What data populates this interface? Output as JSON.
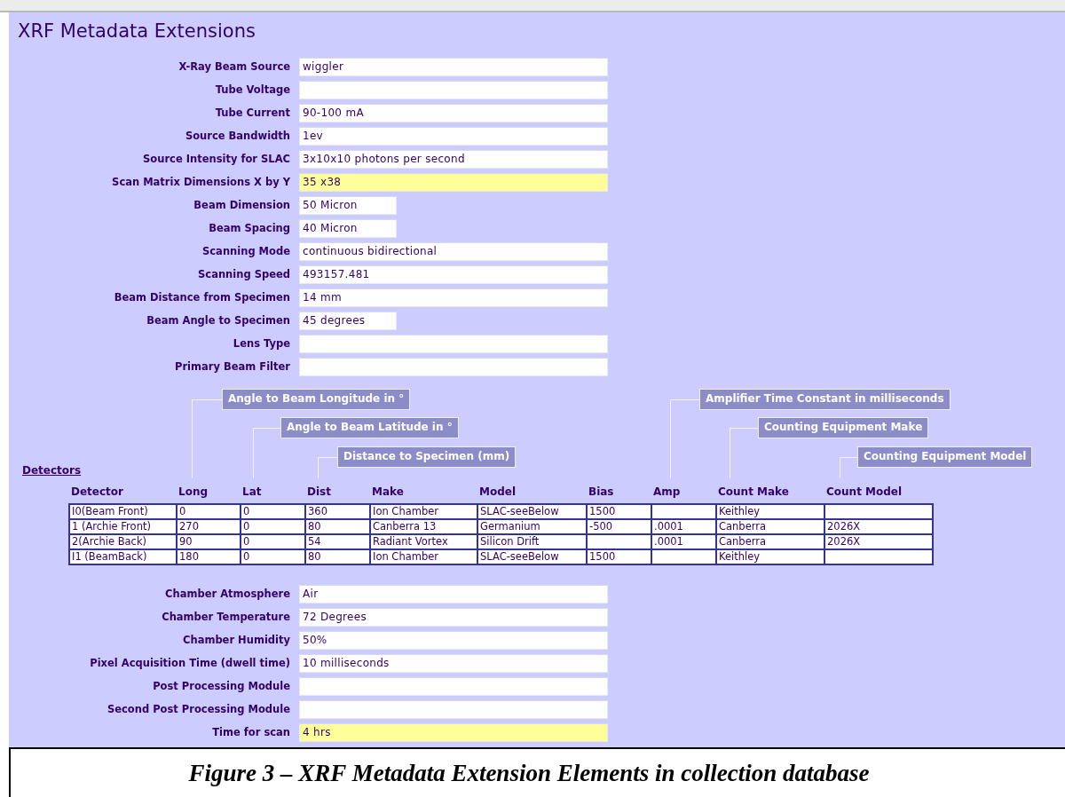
{
  "title": "XRF Metadata Extensions",
  "source_fields": [
    {
      "label": "X-Ray Beam Source",
      "value": "wiggler",
      "kind": "long",
      "highlighted": false
    },
    {
      "label": "Tube Voltage",
      "kind": "long",
      "highlighted": false
    },
    {
      "label": "Tube Current",
      "value": "90-100 mA",
      "kind": "long",
      "highlighted": false
    },
    {
      "label": "Source Bandwidth",
      "value": "1ev",
      "kind": "long",
      "highlighted": false
    },
    {
      "label": "Source Intensity for SLAC",
      "value": "3x10x10 photons per second",
      "kind": "long",
      "highlighted": false
    },
    {
      "label": "Scan Matrix Dimensions X by Y",
      "value": "35 x38",
      "kind": "long",
      "highlighted": true
    },
    {
      "label": "Beam Dimension",
      "value": "50 Micron",
      "kind": "short",
      "highlighted": false
    },
    {
      "label": "Beam Spacing",
      "value": "40 Micron",
      "kind": "short",
      "highlighted": false
    },
    {
      "label": "Scanning Mode",
      "value": "continuous bidirectional",
      "kind": "long",
      "highlighted": false
    },
    {
      "label": "Scanning Speed",
      "value": "493157.481",
      "kind": "long",
      "highlighted": false
    },
    {
      "label": "Beam Distance from Specimen",
      "value": "14 mm",
      "kind": "long",
      "highlighted": false
    },
    {
      "label": "Beam Angle to Specimen",
      "value": "45 degrees",
      "kind": "short",
      "highlighted": false
    },
    {
      "label": "Lens Type",
      "kind": "long",
      "highlighted": false
    },
    {
      "label": "Primary Beam Filter",
      "kind": "long",
      "highlighted": false
    }
  ],
  "callouts": [
    {
      "text": "Angle to Beam Longitude in °"
    },
    {
      "text": "Angle to Beam Latitude in °"
    },
    {
      "text": "Distance to Specimen (mm)"
    },
    {
      "text": "Amplifier Time Constant in milliseconds"
    },
    {
      "text": "Counting Equipment Make"
    },
    {
      "text": "Counting Equipment Model"
    }
  ],
  "detectors_heading": "Detectors",
  "table": {
    "columns": [
      "Detector",
      "Long",
      "Lat",
      "Dist",
      "Make",
      "Model",
      "Bias",
      "Amp",
      "Count Make",
      "Count Model"
    ],
    "rows": [
      [
        "I0(Beam Front)",
        "0",
        "0",
        "360",
        "Ion Chamber",
        "SLAC-seeBelow",
        "1500",
        "",
        "Keithley",
        ""
      ],
      [
        "1 (Archie Front)",
        "270",
        "0",
        "80",
        "Canberra 13",
        "Germanium",
        "-500",
        ".0001",
        "Canberra",
        "2026X"
      ],
      [
        "2(Archie Back)",
        "90",
        "0",
        "54",
        "Radiant Vortex",
        "Silicon Drift",
        "",
        ".0001",
        "Canberra",
        "2026X"
      ],
      [
        "I1 (BeamBack)",
        "180",
        "0",
        "80",
        "Ion Chamber",
        "SLAC-seeBelow",
        "1500",
        "",
        "Keithley",
        ""
      ]
    ]
  },
  "chamber_fields": [
    {
      "label": "Chamber Atmosphere",
      "value": "Air",
      "kind": "long",
      "highlighted": false
    },
    {
      "label": "Chamber Temperature",
      "value": "72 Degrees",
      "kind": "long",
      "highlighted": false
    },
    {
      "label": "Chamber Humidity",
      "value": "50%",
      "kind": "long",
      "highlighted": false
    },
    {
      "label": "Pixel Acquisition Time (dwell time)",
      "value": "10 milliseconds",
      "kind": "long",
      "highlighted": false
    },
    {
      "label": "Post Processing Module",
      "kind": "long",
      "highlighted": false
    },
    {
      "label": "Second Post Processing Module",
      "kind": "long",
      "highlighted": false
    },
    {
      "label": "Time for scan",
      "value": "4 hrs",
      "kind": "long",
      "highlighted": true
    }
  ],
  "caption": "Figure 3 – XRF Metadata Extension Elements in collection database"
}
